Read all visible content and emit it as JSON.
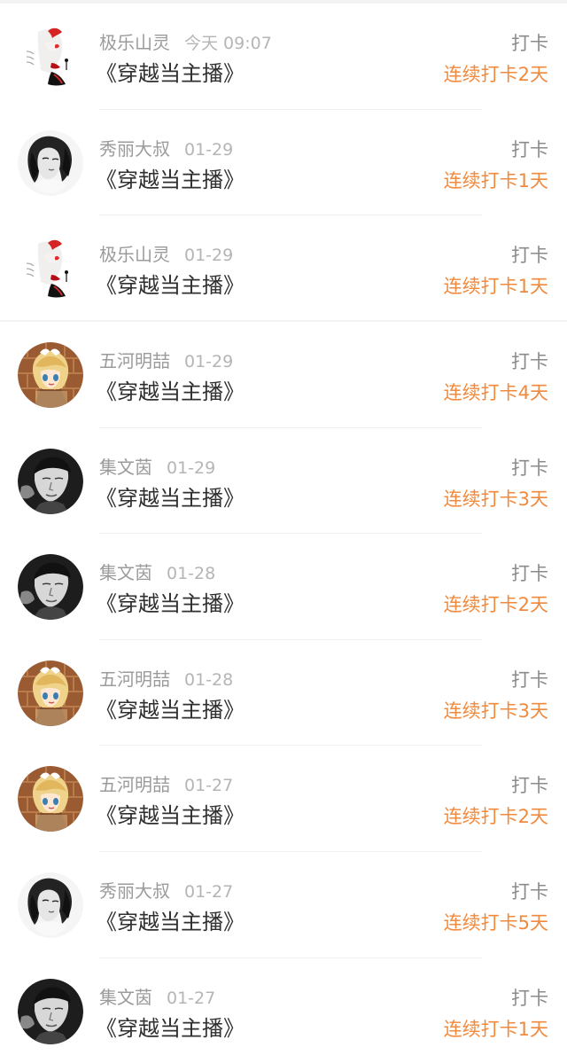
{
  "records": [
    {
      "user": "极乐山灵",
      "date": "今天 09:07",
      "title": "《穿越当主播》",
      "action": "打卡",
      "streak": "连续打卡2天",
      "avatar": "portrait-red-avatar"
    },
    {
      "user": "秀丽大叔",
      "date": "01-29",
      "title": "《穿越当主播》",
      "action": "打卡",
      "streak": "连续打卡1天",
      "avatar": "portrait-bw-woman-avatar"
    },
    {
      "user": "极乐山灵",
      "date": "01-29",
      "title": "《穿越当主播》",
      "action": "打卡",
      "streak": "连续打卡1天",
      "avatar": "portrait-red-avatar"
    },
    {
      "user": "五河明喆",
      "date": "01-29",
      "title": "《穿越当主播》",
      "action": "打卡",
      "streak": "连续打卡4天",
      "avatar": "anime-blonde-avatar"
    },
    {
      "user": "集文茵",
      "date": "01-29",
      "title": "《穿越当主播》",
      "action": "打卡",
      "streak": "连续打卡3天",
      "avatar": "portrait-bw-man-avatar"
    },
    {
      "user": "集文茵",
      "date": "01-28",
      "title": "《穿越当主播》",
      "action": "打卡",
      "streak": "连续打卡2天",
      "avatar": "portrait-bw-man-avatar"
    },
    {
      "user": "五河明喆",
      "date": "01-28",
      "title": "《穿越当主播》",
      "action": "打卡",
      "streak": "连续打卡3天",
      "avatar": "anime-blonde-avatar"
    },
    {
      "user": "五河明喆",
      "date": "01-27",
      "title": "《穿越当主播》",
      "action": "打卡",
      "streak": "连续打卡2天",
      "avatar": "anime-blonde-avatar"
    },
    {
      "user": "秀丽大叔",
      "date": "01-27",
      "title": "《穿越当主播》",
      "action": "打卡",
      "streak": "连续打卡5天",
      "avatar": "portrait-bw-woman-avatar"
    },
    {
      "user": "集文茵",
      "date": "01-27",
      "title": "《穿越当主播》",
      "action": "打卡",
      "streak": "连续打卡1天",
      "avatar": "portrait-bw-man-avatar"
    }
  ],
  "colors": {
    "background": "#f3f3f3",
    "card": "#ffffff",
    "meta_text": "#9b9b9b",
    "title_text": "#2f2f2f",
    "action_text": "#8b8b8b",
    "streak_text": "#f08a3e"
  }
}
